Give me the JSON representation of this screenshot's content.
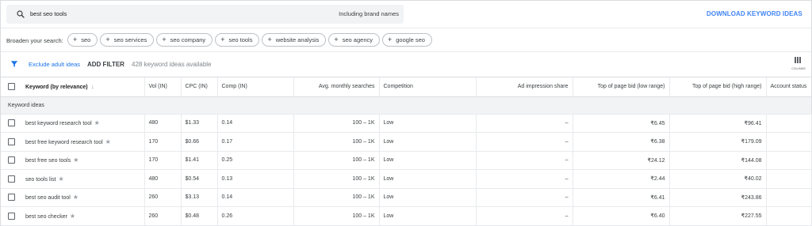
{
  "search": {
    "query": "best seo tools",
    "brand_toggle": "Including brand names",
    "download_label": "DOWNLOAD KEYWORD IDEAS"
  },
  "broaden": {
    "label": "Broaden your search:",
    "chips": [
      "seo",
      "seo services",
      "seo company",
      "seo tools",
      "website analysis",
      "seo agency",
      "google seo"
    ]
  },
  "filters": {
    "exclude_label": "Exclude adult ideas",
    "add_filter_label": "ADD FILTER",
    "available_text": "428 keyword ideas available",
    "columns_label": "COLUMNS"
  },
  "table": {
    "headers": {
      "keyword": "Keyword (by relevance)",
      "vol": "Vol (IN)",
      "cpc": "CPC (IN)",
      "comp": "Comp (IN)",
      "avg_searches": "Avg. monthly searches",
      "competition": "Competition",
      "ad_share": "Ad impression share",
      "bid_low": "Top of page bid (low range)",
      "bid_high": "Top of page bid (high range)",
      "account_status": "Account status"
    },
    "group_label": "Keyword ideas",
    "rows": [
      {
        "keyword": "best keyword research tool",
        "vol": "480",
        "cpc": "$1.33",
        "comp": "0.14",
        "avg": "100 – 1K",
        "competition": "Low",
        "share": "–",
        "low": "₹6.45",
        "high": "₹96.41",
        "status": ""
      },
      {
        "keyword": "best free keyword research tool",
        "vol": "170",
        "cpc": "$0.66",
        "comp": "0.17",
        "avg": "100 – 1K",
        "competition": "Low",
        "share": "–",
        "low": "₹6.38",
        "high": "₹179.09",
        "status": ""
      },
      {
        "keyword": "best free seo tools",
        "vol": "170",
        "cpc": "$1.41",
        "comp": "0.25",
        "avg": "100 – 1K",
        "competition": "Low",
        "share": "–",
        "low": "₹24.12",
        "high": "₹144.08",
        "status": ""
      },
      {
        "keyword": "seo tools list",
        "vol": "480",
        "cpc": "$0.54",
        "comp": "0.13",
        "avg": "100 – 1K",
        "competition": "Low",
        "share": "–",
        "low": "₹2.44",
        "high": "₹40.02",
        "status": ""
      },
      {
        "keyword": "best seo audit tool",
        "vol": "260",
        "cpc": "$3.13",
        "comp": "0.14",
        "avg": "100 – 1K",
        "competition": "Low",
        "share": "–",
        "low": "₹6.41",
        "high": "₹243.86",
        "status": ""
      },
      {
        "keyword": "best seo checker",
        "vol": "260",
        "cpc": "$0.48",
        "comp": "0.26",
        "avg": "100 – 1K",
        "competition": "Low",
        "share": "–",
        "low": "₹6.40",
        "high": "₹227.55",
        "status": ""
      }
    ]
  },
  "icons": {
    "search": "search-icon",
    "filter": "filter-icon",
    "columns": "columns-icon",
    "star": "star-icon",
    "sort": "arrow-down-icon",
    "plus": "plus-icon"
  },
  "colors": {
    "accent": "#4285f4",
    "link": "#1a73e8",
    "group_bg": "#f1f3f4"
  }
}
